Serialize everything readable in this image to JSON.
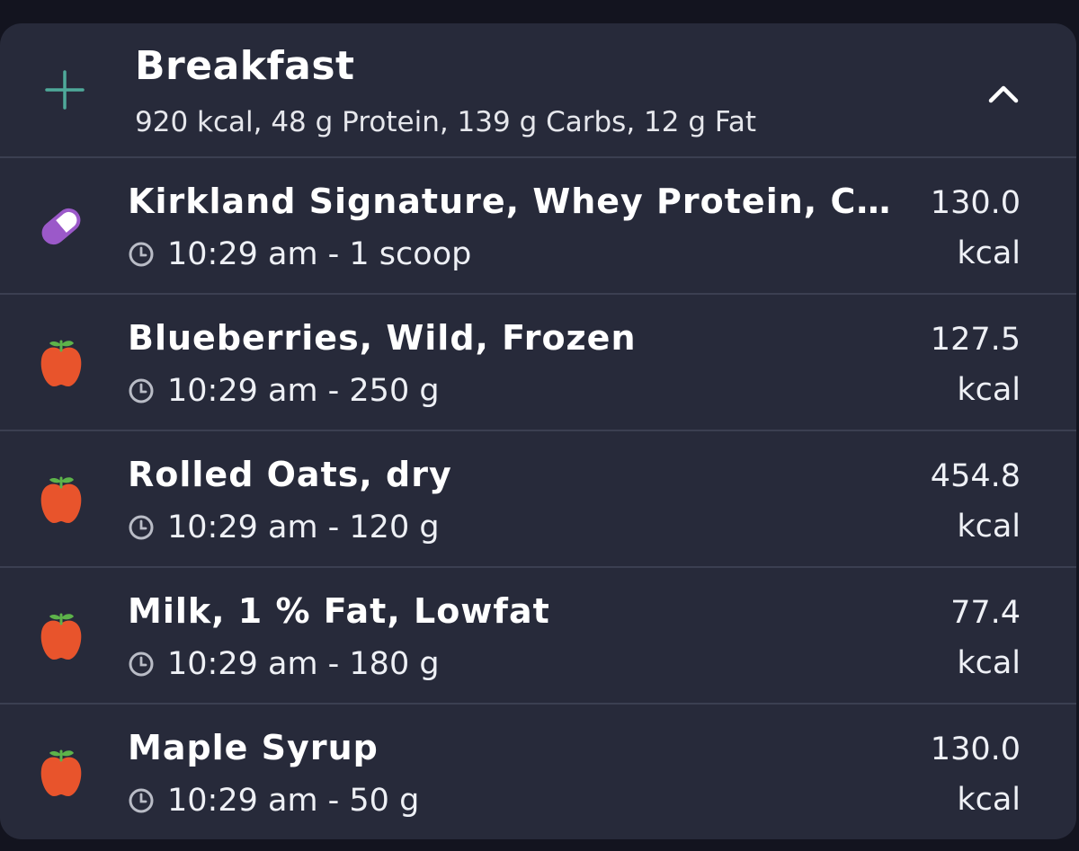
{
  "meal": {
    "title": "Breakfast",
    "summary": "920 kcal, 48 g Protein, 139 g Carbs, 12 g Fat",
    "expanded": true
  },
  "colors": {
    "background": "#13141f",
    "card": "#272a3a",
    "divider": "#3b3f51",
    "add_icon": "#4fa99a",
    "supplement_icon": "#9b59c9",
    "food_icon": "#e8542c",
    "leaf": "#5db34a"
  },
  "entries": [
    {
      "name": "Kirkland Signature, Whey Protein, Cre…",
      "time_amount": "10:29 am - 1 scoop",
      "kcal_value": "130.0",
      "kcal_unit": "kcal",
      "icon": "pill-icon"
    },
    {
      "name": "Blueberries, Wild, Frozen",
      "time_amount": "10:29 am - 250 g",
      "kcal_value": "127.5",
      "kcal_unit": "kcal",
      "icon": "apple-icon"
    },
    {
      "name": "Rolled Oats, dry",
      "time_amount": "10:29 am - 120 g",
      "kcal_value": "454.8",
      "kcal_unit": "kcal",
      "icon": "apple-icon"
    },
    {
      "name": "Milk, 1 % Fat, Lowfat",
      "time_amount": "10:29 am - 180 g",
      "kcal_value": "77.4",
      "kcal_unit": "kcal",
      "icon": "apple-icon"
    },
    {
      "name": "Maple Syrup",
      "time_amount": "10:29 am - 50 g",
      "kcal_value": "130.0",
      "kcal_unit": "kcal",
      "icon": "apple-icon"
    }
  ]
}
